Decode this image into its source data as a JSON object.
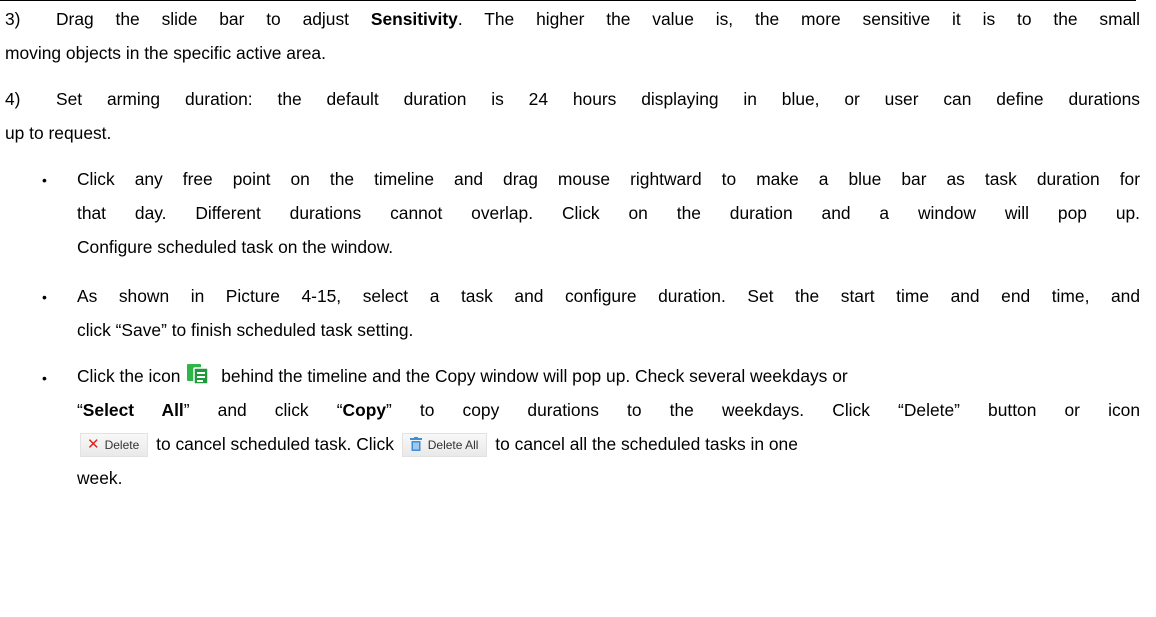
{
  "p3": {
    "num": "3)",
    "l1_pre": "Drag the slide bar to adjust ",
    "l1_bold": "Sensitivity",
    "l1_post": ". The higher the value is, the more sensitive it is to the small",
    "l2": "moving objects in the specific active area."
  },
  "p4": {
    "num": "4)",
    "l1": "Set arming duration: the default duration is 24 hours displaying in blue, or user can define durations",
    "l2": "up to request."
  },
  "b1": {
    "l1": "Click any free point on the timeline and drag mouse rightward to make a blue bar as task duration for",
    "l2": "that day. Different durations cannot overlap. Click on the duration and a window will pop up.",
    "l3": "Configure scheduled task on the window."
  },
  "b2": {
    "l1": "As shown in Picture 4-15, select a task and configure duration. Set the start time and end time, and",
    "l2": "click “Save” to finish scheduled task setting."
  },
  "b3": {
    "l1_a": "Click the icon",
    "l1_b": "behind the timeline and the Copy window will pop up. Check several weekdays or",
    "l2_a": "“",
    "l2_bold1": "Select All",
    "l2_b": "” and click “",
    "l2_bold2": "Copy",
    "l2_c": "” to copy durations to the weekdays. Click “Delete” button or icon",
    "l3_b": "to cancel scheduled task. Click",
    "l3_c": "to cancel all the scheduled tasks in one",
    "l4": "week."
  },
  "buttons": {
    "delete_label": "Delete",
    "delete_all_label": "Delete All"
  },
  "bullet_glyph": "•",
  "colors": {
    "copy_icon": "#2fb54a",
    "delete_x": "#e0251b",
    "delete_all_icon": "#3d8fd6"
  }
}
